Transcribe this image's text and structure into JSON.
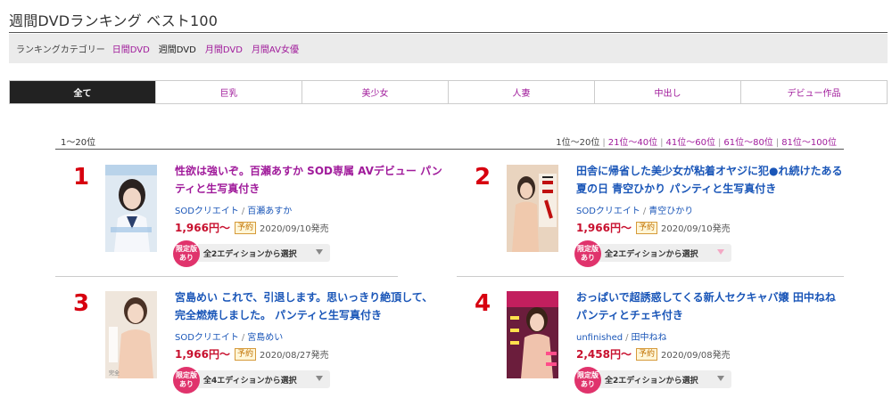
{
  "page": {
    "title": "週間DVDランキング ベスト100"
  },
  "categories": {
    "label": "ランキングカテゴリー",
    "items": [
      {
        "label": "日間DVD",
        "current": false
      },
      {
        "label": "週間DVD",
        "current": true
      },
      {
        "label": "月間DVD",
        "current": false
      },
      {
        "label": "月間AV女優",
        "current": false
      }
    ]
  },
  "tabs": [
    {
      "label": "全て",
      "active": true
    },
    {
      "label": "巨乳",
      "active": false
    },
    {
      "label": "美少女",
      "active": false
    },
    {
      "label": "人妻",
      "active": false
    },
    {
      "label": "中出し",
      "active": false
    },
    {
      "label": "デビュー作品",
      "active": false
    }
  ],
  "range": {
    "current": "1〜20位",
    "links": [
      {
        "label": "1位〜20位",
        "current": true
      },
      {
        "label": "21位〜40位",
        "current": false
      },
      {
        "label": "41位〜60位",
        "current": false
      },
      {
        "label": "61位〜80位",
        "current": false
      },
      {
        "label": "81位〜100位",
        "current": false
      }
    ]
  },
  "colors": {
    "link": "#a01b9b",
    "rank": "#d7000f",
    "price": "#c8102e",
    "badge": "#e0336c",
    "blue_link": "#1a56b8"
  },
  "items": [
    {
      "rank": "1",
      "title": "性欲は強いぞ。百瀬あすか SOD専属 AVデビュー パンティと生写真付き",
      "maker": "SODクリエイト",
      "actress": "百瀬あすか",
      "price": "1,966円〜",
      "yoyaku": "予約",
      "release": "2020/09/10発売",
      "badge": "限定版あり",
      "select": "全2エディションから選択"
    },
    {
      "rank": "2",
      "title": "田舎に帰省した美少女が粘着オヤジに犯●れ続けたある夏の日 青空ひかり パンティと生写真付き",
      "maker": "SODクリエイト",
      "actress": "青空ひかり",
      "price": "1,966円〜",
      "yoyaku": "予約",
      "release": "2020/09/10発売",
      "badge": "限定版あり",
      "select": "全2エディションから選択"
    },
    {
      "rank": "3",
      "title": "宮島めい これで、引退します。思いっきり絶頂して、完全燃焼しました。 パンティと生写真付き",
      "maker": "SODクリエイト",
      "actress": "宮島めい",
      "price": "1,966円〜",
      "yoyaku": "予約",
      "release": "2020/08/27発売",
      "badge": "限定版あり",
      "select": "全4エディションから選択"
    },
    {
      "rank": "4",
      "title": "おっぱいで超誘惑してくる新人セクキャバ嬢 田中ねね パンティとチェキ付き",
      "maker": "unfinished",
      "actress": "田中ねね",
      "price": "2,458円〜",
      "yoyaku": "予約",
      "release": "2020/09/08発売",
      "badge": "限定版あり",
      "select": "全2エディションから選択"
    }
  ]
}
